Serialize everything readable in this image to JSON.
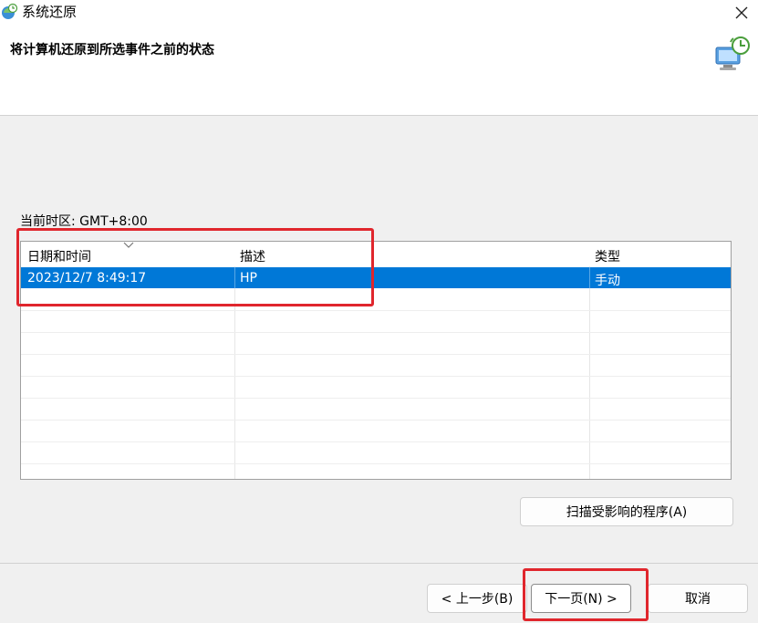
{
  "window": {
    "title": "系统还原",
    "icon": "system-restore-icon",
    "close_icon": "close-icon"
  },
  "header": {
    "title": "将计算机还原到所选事件之前的状态",
    "icon": "system-restore-large-icon"
  },
  "timezone_label": "当前时区: GMT+8:00",
  "table": {
    "columns": [
      "日期和时间",
      "描述",
      "类型"
    ],
    "sorted_column": "日期和时间",
    "rows": [
      {
        "datetime": "2023/12/7 8:49:17",
        "description": "HP",
        "type": "手动",
        "selected": true
      }
    ]
  },
  "buttons": {
    "scan": "扫描受影响的程序(A)",
    "back": "< 上一步(B)",
    "next": "下一页(N) >",
    "cancel": "取消"
  },
  "colors": {
    "selection": "#0078d7",
    "highlight": "#e0262d"
  }
}
